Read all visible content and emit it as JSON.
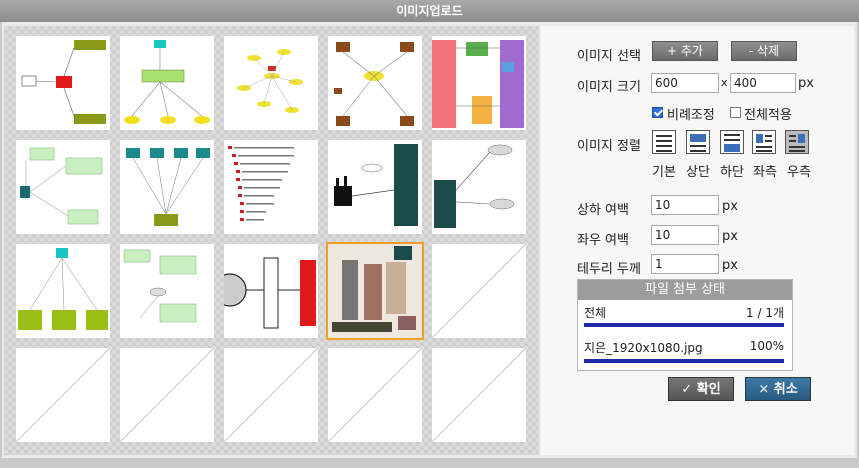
{
  "window": {
    "title": "이미지업로드"
  },
  "controls": {
    "image_select_label": "이미지 선택",
    "add_button": "+ 추가",
    "delete_button": "- 삭제",
    "image_size_label": "이미지 크기",
    "width_value": "600",
    "size_separator": "x",
    "height_value": "400",
    "size_unit": "px",
    "keep_ratio_label": "비례조정",
    "keep_ratio_checked": true,
    "apply_all_label": "전체적용",
    "apply_all_checked": false,
    "align_label": "이미지 정렬",
    "align_options": [
      "기본",
      "상단",
      "하단",
      "좌측",
      "우측"
    ],
    "align_selected": "우측",
    "vmargin_label": "상하 여백",
    "vmargin_value": "10",
    "hmargin_label": "좌우 여백",
    "hmargin_value": "10",
    "border_label": "테두리 두께",
    "border_value": "1",
    "unit": "px"
  },
  "attach_status": {
    "header": "파일 첨부 상태",
    "total_label": "전체",
    "total_count": "1 / 1개",
    "total_progress": 1.0,
    "file_name": "지은_1920x1080.jpg",
    "file_percent": "100%",
    "file_progress": 1.0
  },
  "actions": {
    "confirm": "확인",
    "cancel": "취소"
  },
  "gallery": {
    "thumbnails": 14,
    "empty_slots": 6,
    "selected_index": 13
  },
  "colors": {
    "selected_outline": "#f0a020",
    "confirm_bg": "#5f5f5f",
    "cancel_bg": "#2c5f86",
    "progress": "#1e2aa8"
  }
}
